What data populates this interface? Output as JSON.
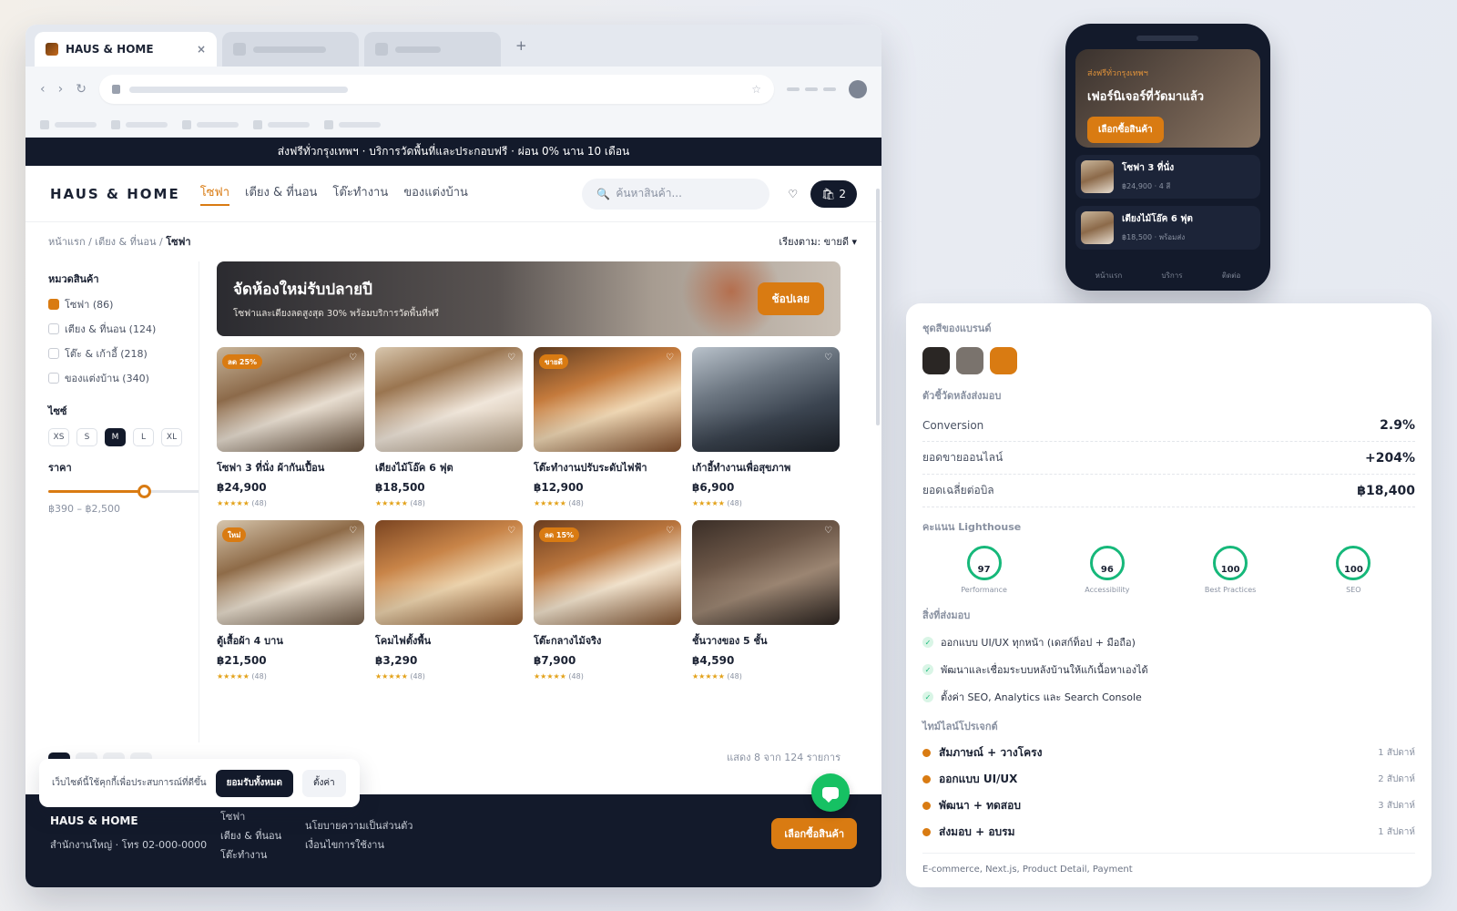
{
  "browser": {
    "tab_title": "HAUS & HOME",
    "tab_close": "×",
    "new_tab": "+"
  },
  "site": {
    "promo": "ส่งฟรีทั่วกรุงเทพฯ · บริการวัดพื้นที่และประกอบฟรี · ผ่อน 0% นาน 10 เดือน",
    "logo": "HAUS & HOME",
    "nav": [
      "โซฟา",
      "เตียง & ที่นอน",
      "โต๊ะทำงาน",
      "ของแต่งบ้าน"
    ],
    "search_placeholder": "ค้นหาสินค้า...",
    "cart_count": "2",
    "breadcrumb": "หน้าแรก / เตียง & ที่นอน /",
    "breadcrumb_current": "โซฟา",
    "sort": "เรียงตาม: ขายดี",
    "sidebar": {
      "category_title": "หมวดสินค้า",
      "categories": [
        "โซฟา (86)",
        "เตียง & ที่นอน (124)",
        "โต๊ะ & เก้าอี้ (218)",
        "ของแต่งบ้าน (340)"
      ],
      "size_title": "ไซซ์",
      "sizes": [
        "XS",
        "S",
        "M",
        "L",
        "XL"
      ],
      "selected_size": "M",
      "price_title": "ราคา",
      "price_range": "฿390 – ฿2,500",
      "price_slider_level": 0.63
    },
    "banner": {
      "title": "จัดห้องใหม่รับปลายปี",
      "subtitle": "โซฟาและเตียงลดสูงสุด 30% พร้อมบริการวัดพื้นที่ฟรี",
      "button": "ช้อปเลย"
    },
    "products": [
      {
        "name": "โซฟา 3 ที่นั่ง ผ้ากันเปื้อน",
        "price": "฿24,900",
        "stars": "★★★★★",
        "reviews": "(48)",
        "badge": "ลด 25%"
      },
      {
        "name": "เตียงไม้โอ๊ค 6 ฟุต",
        "price": "฿18,500",
        "stars": "★★★★★",
        "reviews": "(48)",
        "badge": ""
      },
      {
        "name": "โต๊ะทำงานปรับระดับไฟฟ้า",
        "price": "฿12,900",
        "stars": "★★★★★",
        "reviews": "(48)",
        "badge": "ขายดี"
      },
      {
        "name": "เก้าอี้ทำงานเพื่อสุขภาพ",
        "price": "฿6,900",
        "stars": "★★★★★",
        "reviews": "(48)",
        "badge": ""
      },
      {
        "name": "ตู้เสื้อผ้า 4 บาน",
        "price": "฿21,500",
        "stars": "★★★★★",
        "reviews": "(48)",
        "badge": "ใหม่"
      },
      {
        "name": "โคมไฟตั้งพื้น",
        "price": "฿3,290",
        "stars": "★★★★★",
        "reviews": "(48)",
        "badge": ""
      },
      {
        "name": "โต๊ะกลางไม้จริง",
        "price": "฿7,900",
        "stars": "★★★★★",
        "reviews": "(48)",
        "badge": "ลด 15%"
      },
      {
        "name": "ชั้นวางของ 5 ชั้น",
        "price": "฿4,590",
        "stars": "★★★★★",
        "reviews": "(48)",
        "badge": ""
      }
    ],
    "showing": "แสดง 8 จาก 124 รายการ",
    "cookie": {
      "text": "เว็บไซต์นี้ใช้คุกกี้เพื่อประสบการณ์ที่ดีขึ้น",
      "accept": "ยอมรับทั้งหมด",
      "settings": "ตั้งค่า"
    },
    "footer": {
      "brand": "HAUS & HOME",
      "address": "สำนักงานใหญ่ · โทร 02-000-0000",
      "links": [
        "โซฟา",
        "เตียง & ที่นอน",
        "โต๊ะทำงาน"
      ],
      "links2": [
        "นโยบายความเป็นส่วนตัว",
        "เงื่อนไขการใช้งาน"
      ],
      "button": "เลือกซื้อสินค้า"
    }
  },
  "phone": {
    "eyebrow": "ส่งฟรีทั่วกรุงเทพฯ",
    "title": "เฟอร์นิเจอร์ที่วัดมาแล้ว",
    "button": "เลือกซื้อสินค้า",
    "items": [
      {
        "name": "โซฟา 3 ที่นั่ง",
        "meta": "฿24,900 · 4 สี"
      },
      {
        "name": "เตียงไม้โอ๊ค 6 ฟุต",
        "meta": "฿18,500 · พร้อมส่ง"
      }
    ],
    "tabs": [
      "หน้าแรก",
      "บริการ",
      "ติดต่อ"
    ]
  },
  "panel": {
    "brand_colors_title": "ชุดสีของแบรนด์",
    "colors": [
      "#2a2624",
      "#7a736d",
      "#d97b12"
    ],
    "metrics_title": "ตัวชี้วัดหลังส่งมอบ",
    "metrics": [
      {
        "label": "Conversion",
        "value": "2.9%"
      },
      {
        "label": "ยอดขายออนไลน์",
        "value": "+204%"
      },
      {
        "label": "ยอดเฉลี่ยต่อบิล",
        "value": "฿18,400"
      }
    ],
    "lighthouse_title": "คะแนน Lighthouse",
    "scores": [
      {
        "value": "97",
        "label": "Performance"
      },
      {
        "value": "96",
        "label": "Accessibility"
      },
      {
        "value": "100",
        "label": "Best Practices"
      },
      {
        "value": "100",
        "label": "SEO"
      }
    ],
    "deliverables_title": "สิ่งที่ส่งมอบ",
    "deliverables": [
      "ออกแบบ UI/UX ทุกหน้า (เดสก์ท็อป + มือถือ)",
      "พัฒนาและเชื่อมระบบหลังบ้านให้แก้เนื้อหาเองได้",
      "ตั้งค่า SEO, Analytics และ Search Console"
    ],
    "timeline_title": "ไทม์ไลน์โปรเจกต์",
    "timeline": [
      {
        "step": "สัมภาษณ์ + วางโครง",
        "duration": "1 สัปดาห์"
      },
      {
        "step": "ออกแบบ UI/UX",
        "duration": "2 สัปดาห์"
      },
      {
        "step": "พัฒนา + ทดสอบ",
        "duration": "3 สัปดาห์"
      },
      {
        "step": "ส่งมอบ + อบรม",
        "duration": "1 สัปดาห์"
      }
    ],
    "tags": "E-commerce, Next.js, Product Detail, Payment"
  }
}
